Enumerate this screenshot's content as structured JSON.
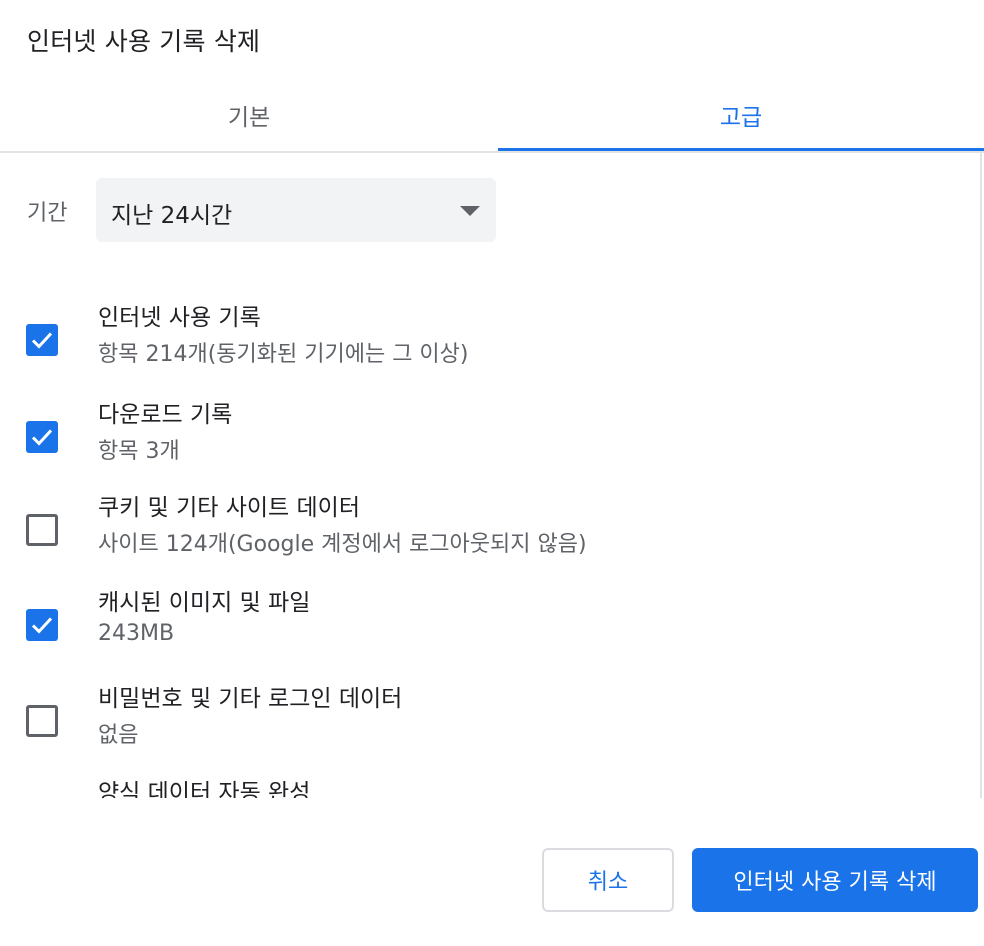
{
  "dialog": {
    "title": "인터넷 사용 기록 삭제"
  },
  "tabs": [
    {
      "label": "기본",
      "active": false
    },
    {
      "label": "고급",
      "active": true
    }
  ],
  "period": {
    "label": "기간",
    "selected": "지난 24시간"
  },
  "options": [
    {
      "title": "인터넷 사용 기록",
      "subtitle": "항목 214개(동기화된 기기에는 그 이상)",
      "checked": true
    },
    {
      "title": "다운로드 기록",
      "subtitle": "항목 3개",
      "checked": true
    },
    {
      "title": "쿠키 및 기타 사이트 데이터",
      "subtitle": "사이트 124개(Google 계정에서 로그아웃되지 않음)",
      "checked": false
    },
    {
      "title": "캐시된 이미지 및 파일",
      "subtitle": "243MB",
      "checked": true
    },
    {
      "title": "비밀번호 및 기타 로그인 데이터",
      "subtitle": "없음",
      "checked": false
    },
    {
      "title": "양식 데이터 자동 완성",
      "subtitle": "",
      "checked": false
    }
  ],
  "buttons": {
    "cancel": "취소",
    "delete": "인터넷 사용 기록 삭제"
  },
  "colors": {
    "accent": "#1a73e8",
    "text_primary": "#202124",
    "text_secondary": "#5f6368"
  },
  "icons": {
    "check": "check-icon",
    "dropdown": "caret-down-icon"
  }
}
